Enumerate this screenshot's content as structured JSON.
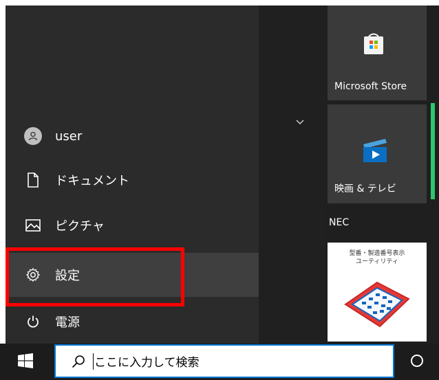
{
  "start_menu": {
    "rail": {
      "items": [
        {
          "label": "user",
          "icon": "user-avatar-icon"
        },
        {
          "label": "ドキュメント",
          "icon": "document-icon"
        },
        {
          "label": "ピクチャ",
          "icon": "picture-icon"
        },
        {
          "label": "設定",
          "icon": "gear-icon",
          "selected": true
        },
        {
          "label": "電源",
          "icon": "power-icon"
        }
      ]
    },
    "tiles": {
      "store": {
        "label": "Microsoft Store",
        "icon": "store-bag-icon"
      },
      "movies": {
        "label": "映画 & テレビ",
        "icon": "movies-play-icon"
      },
      "group_header": "NEC",
      "serial_tile": {
        "line1": "型番・製造番号表示",
        "line2": "ユーティリティ",
        "icon": "keyboard-icon"
      }
    }
  },
  "taskbar": {
    "search_placeholder": "ここに入力して検索",
    "start_icon": "windows-logo-icon",
    "cortana_icon": "cortana-circle-icon"
  },
  "colors": {
    "highlight": "#ff0000",
    "taskbar_bg": "#1c1c1c",
    "search_border": "#0078d7",
    "accent_green": "#2ec86b"
  }
}
